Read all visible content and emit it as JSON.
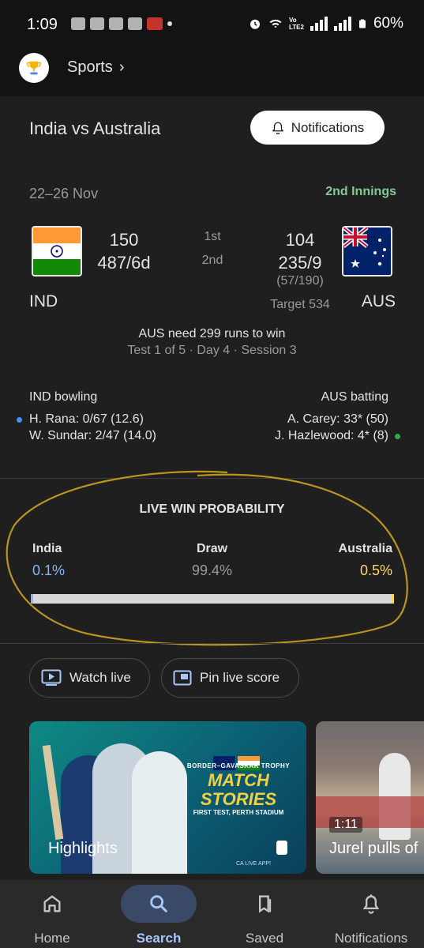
{
  "status_bar": {
    "time": "1:09",
    "battery": "60%",
    "network_label_1": "Vo",
    "network_label_2": "LTE2"
  },
  "header": {
    "breadcrumb": "Sports",
    "chevron": "›"
  },
  "match": {
    "title": "India vs Australia",
    "notifications_label": "Notifications",
    "dates": "22–26 Nov",
    "innings_status": "2nd Innings",
    "team_home": {
      "abbr": "IND",
      "score_1st": "150",
      "score_2nd": "487/6d"
    },
    "team_away": {
      "abbr": "AUS",
      "score_1st": "104",
      "score_2nd": "235/9",
      "overs": "(57/190)",
      "target": "Target 534"
    },
    "innings_labels": [
      "1st",
      "2nd"
    ],
    "need_text": "AUS need 299 runs to win",
    "session_text": "Test 1 of 5 · Day 4 · Session 3",
    "bowling": {
      "heading": "IND bowling",
      "players": [
        "H. Rana: 0/67 (12.6)",
        "W. Sundar: 2/47 (14.0)"
      ]
    },
    "batting": {
      "heading": "AUS batting",
      "players": [
        "A. Carey: 33* (50)",
        "J. Hazlewood: 4* (8)"
      ]
    }
  },
  "win_probability": {
    "title": "LIVE WIN PROBABILITY",
    "india": {
      "label": "India",
      "value": "0.1%",
      "fraction": 0.001
    },
    "draw": {
      "label": "Draw",
      "value": "99.4%",
      "fraction": 0.994
    },
    "australia": {
      "label": "Australia",
      "value": "0.5%",
      "fraction": 0.005
    },
    "colors": {
      "india": "#8ab4f8",
      "draw": "#d8d8d8",
      "australia": "#fdd663"
    }
  },
  "actions": {
    "watch_live": "Watch live",
    "pin_live_score": "Pin live score"
  },
  "videos": [
    {
      "title": "Highlights",
      "overlay_subtitle": "BORDER–GAVASKAR TROPHY",
      "overlay_title": "MATCH STORIES",
      "overlay_subline": "FIRST TEST, PERTH STADIUM",
      "overlay_tag": "CA LIVE APP!"
    },
    {
      "title": "Jurel pulls of",
      "duration": "1:11"
    }
  ],
  "bottom_nav": [
    {
      "label": "Home",
      "icon": "home-icon",
      "active": false
    },
    {
      "label": "Search",
      "icon": "search-icon",
      "active": true
    },
    {
      "label": "Saved",
      "icon": "bookmarks-icon",
      "active": false
    },
    {
      "label": "Notifications",
      "icon": "bell-icon",
      "active": false
    }
  ]
}
